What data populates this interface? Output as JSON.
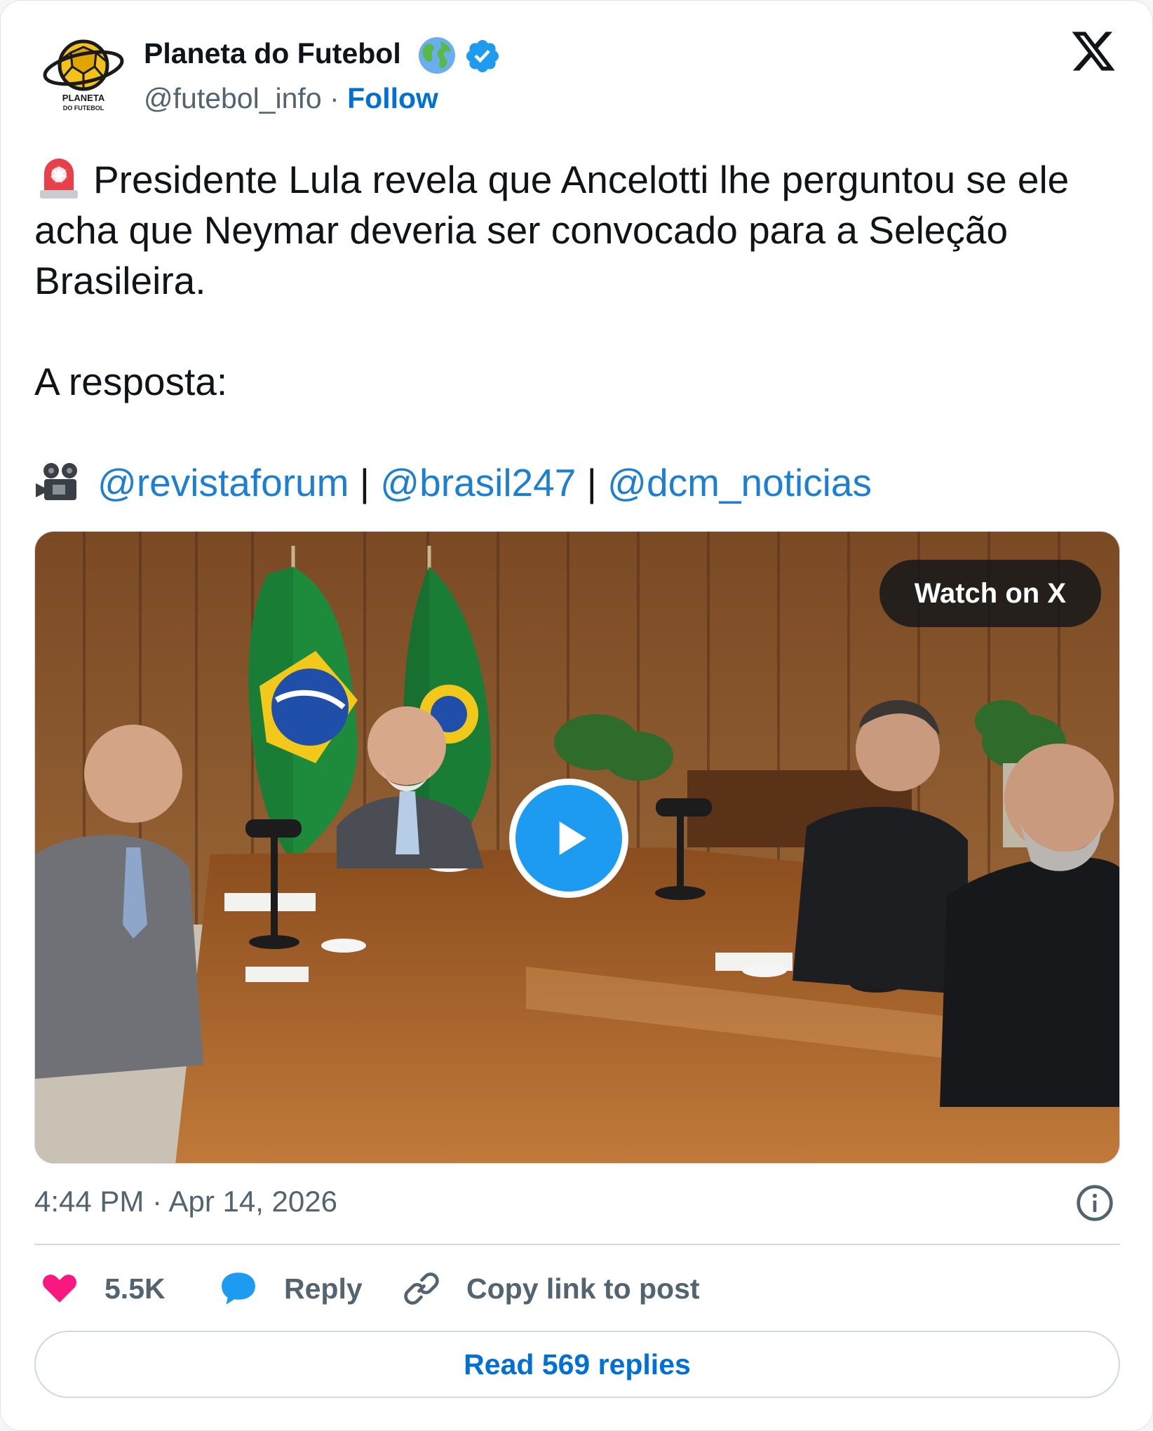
{
  "author": {
    "name": "Planeta do Futebol",
    "handle": "@futebol_info",
    "separator": "·",
    "follow_label": "Follow",
    "avatar_text": "PLANETA DO FUTEBOL"
  },
  "icons": {
    "globe": "globe-icon",
    "verified": "verified-badge-icon",
    "brand": "x-logo-icon",
    "siren": "siren-emoji-icon",
    "camera": "movie-camera-emoji-icon",
    "play": "play-icon",
    "info": "info-icon",
    "heart": "heart-icon",
    "reply": "reply-bubble-icon",
    "link": "link-icon"
  },
  "tweet": {
    "line1": "Presidente Lula revela que Ancelotti lhe perguntou se ele acha que Neymar deveria ser convocado para a Seleção Brasileira.",
    "line2": "A resposta:",
    "mentions": [
      "@revistaforum",
      "@brasil247",
      "@dcm_noticias"
    ],
    "mention_separator": " | "
  },
  "media": {
    "watch_label": "Watch on X"
  },
  "meta": {
    "time": "4:44 PM",
    "separator": "·",
    "date": "Apr 14, 2026"
  },
  "actions": {
    "likes": "5.5K",
    "reply_label": "Reply",
    "copy_label": "Copy link to post"
  },
  "footer": {
    "read_replies_label": "Read 569 replies"
  },
  "colors": {
    "link": "#006fd6",
    "mention": "#1d7fd1",
    "heart": "#f91880",
    "reply_icon": "#1d9bf0",
    "muted": "#536471",
    "play": "#1d9bf0"
  }
}
